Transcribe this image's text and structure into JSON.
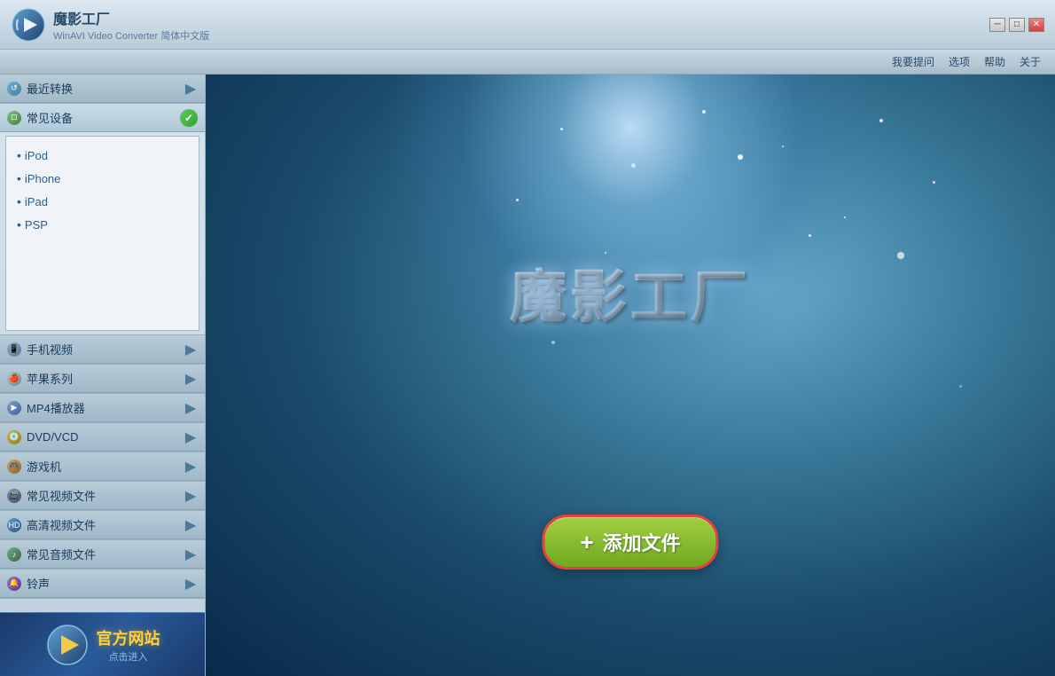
{
  "titleBar": {
    "appName": "魔影工厂",
    "subtitle": "WinAVI Video Converter 简体中文版",
    "minBtn": "─",
    "maxBtn": "□",
    "closeBtn": "✕"
  },
  "menuBar": {
    "items": [
      "我要提问",
      "选项",
      "帮助",
      "关于"
    ]
  },
  "sidebar": {
    "recentSection": {
      "label": "最近转换",
      "collapsed": true
    },
    "commonDevicesSection": {
      "label": "常见设备",
      "expanded": true,
      "devices": [
        "iPod",
        "iPhone",
        "iPad",
        "PSP"
      ]
    },
    "mobileVideo": {
      "label": "手机视频"
    },
    "appleSection": {
      "label": "苹果系列"
    },
    "mp4Section": {
      "label": "MP4播放器"
    },
    "dvdSection": {
      "label": "DVD/VCD"
    },
    "gameSection": {
      "label": "游戏机"
    },
    "commonVideoSection": {
      "label": "常见视频文件"
    },
    "hdVideoSection": {
      "label": "高清视频文件"
    },
    "commonAudioSection": {
      "label": "常见音频文件"
    },
    "ringtoneSection": {
      "label": "铃声"
    }
  },
  "content": {
    "appTitle": "魔影工厂",
    "addFileBtn": "+ 添加文件"
  },
  "banner": {
    "title": "官方网站",
    "subtitle": "点击进入"
  }
}
